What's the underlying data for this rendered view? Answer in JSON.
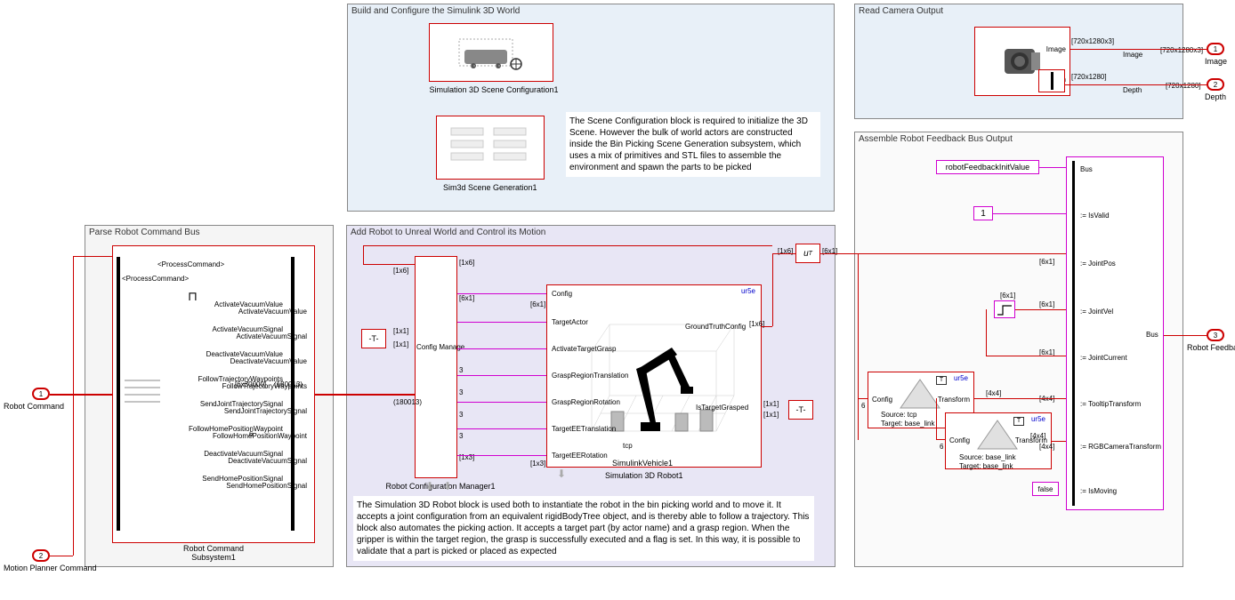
{
  "panels": {
    "parse": {
      "title": "Parse Robot Command Bus"
    },
    "build": {
      "title": "Build and Configure the Simulink 3D World"
    },
    "addRobot": {
      "title": "Add Robot to Unreal World and Control its Motion"
    },
    "readCam": {
      "title": "Read Camera Output"
    },
    "assemble": {
      "title": "Assemble Robot Feedback Bus Output"
    }
  },
  "ports": {
    "in1": {
      "num": "1",
      "label": "Robot Command"
    },
    "in2": {
      "num": "2",
      "label": "Motion Planner Command"
    },
    "out1": {
      "num": "1",
      "label": "Image"
    },
    "out2": {
      "num": "2",
      "label": "Depth"
    },
    "out3": {
      "num": "3",
      "label": "Robot Feedback"
    }
  },
  "parse": {
    "subsystemLabel": "Robot Command\nSubsystem1",
    "sig": "<ProcessCommand>",
    "signals": [
      "ActivateVacuumValue",
      "ActivateVacuumSignal",
      "DeactivateVacuumValue",
      "FollowTrajectoryWaypoints",
      "SendJointTrajectorySignal",
      "FollowHomePositionWaypoint",
      "DeactivateVacuumSignal",
      "SendHomePositionSignal"
    ],
    "d1": "[6x30000]",
    "d2": "(180013)",
    "d3": "6"
  },
  "build": {
    "block1Label": "Simulation 3D Scene Configuration1",
    "block2Label": "Sim3d Scene Generation1",
    "desc": "The Scene Configuration block is required to initialize the 3D Scene. However the bulk of world actors are constructed inside the Bin Picking Scene Generation subsystem, which uses a mix of primitives and STL files to assemble the environment and spawn the parts to be picked"
  },
  "addRobot": {
    "block1Label": "Robot Configuration  Manager1",
    "block2Label": "Simulation 3D Robot1",
    "vehicleLabel": "SimulinkVehicle1",
    "tcpLabel": "tcp",
    "desc": "The Simulation 3D Robot block is used both to instantiate the robot in the bin picking world and to move it. It accepts a joint configuration from an equivalent rigidBodyTree object, and is thereby able to follow a trajectory. This block also automates the picking action. It accepts a target part (by actor name) and a grasp region. When the gripper is within the target region, the grasp is successfully executed and a flag is set. In this way, it is possible to validate that a part is picked or placed as expected",
    "ur5e": "ur5e",
    "configManage": "Config Manage",
    "inPorts": [
      "Config",
      "TargetActor",
      "ActivateTargetGrasp",
      "GraspRegionTranslation",
      "GraspRegionRotation",
      "TargetEETranslation",
      "TargetEERotation"
    ],
    "outPorts": [
      "GroundTruthConfig",
      "IsTargetGrasped"
    ],
    "dims": {
      "d1x6": "[1x6]",
      "d6x1": "[6x1]",
      "d1x1": "[1x1]",
      "d1x3": "[1x3]",
      "d180": "(180013)"
    },
    "T": "-T-",
    "uT": "u",
    "three": "3"
  },
  "readCam": {
    "imgLabel": "Image",
    "depthLabel": "Depth",
    "dim1": "[720x1280x3]",
    "dim2": "[720x1280]"
  },
  "assemble": {
    "initVal": "robotFeedbackInitValue",
    "one": "1",
    "false": "false",
    "busPorts": [
      "Bus",
      ":= IsValid",
      ":= JointPos",
      ":= JointVel",
      ":= JointCurrent",
      ":= TooltipTransform",
      ":= RGBCameraTransform",
      ":= IsMoving"
    ],
    "busOut": "Bus",
    "ur5e": "ur5e",
    "config": "Config",
    "transform": "Transform",
    "src1": "Source: tcp",
    "tgt1": "Target: base_link",
    "src2": "Source: base_link",
    "tgt2": "Target: base_link",
    "dims": {
      "d6x1": "[6x1]",
      "d4x4": "[4x4]"
    },
    "six": "6",
    "T": "T"
  }
}
